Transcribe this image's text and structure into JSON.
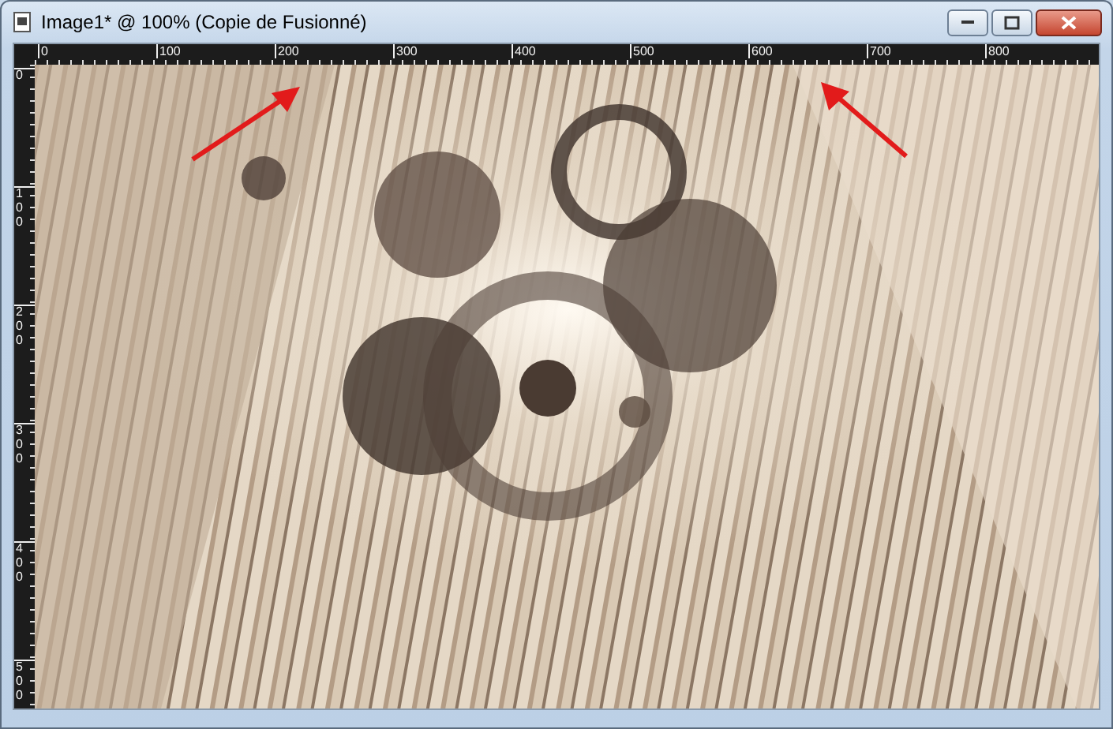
{
  "window": {
    "title": "Image1* @ 100% (Copie de Fusionné)"
  },
  "horizontal_ruler": {
    "labels": [
      "0",
      "100",
      "200",
      "300",
      "400",
      "500",
      "600",
      "700",
      "800"
    ]
  },
  "vertical_ruler": {
    "labels": [
      "0",
      "100",
      "200",
      "300",
      "400",
      "500"
    ]
  }
}
